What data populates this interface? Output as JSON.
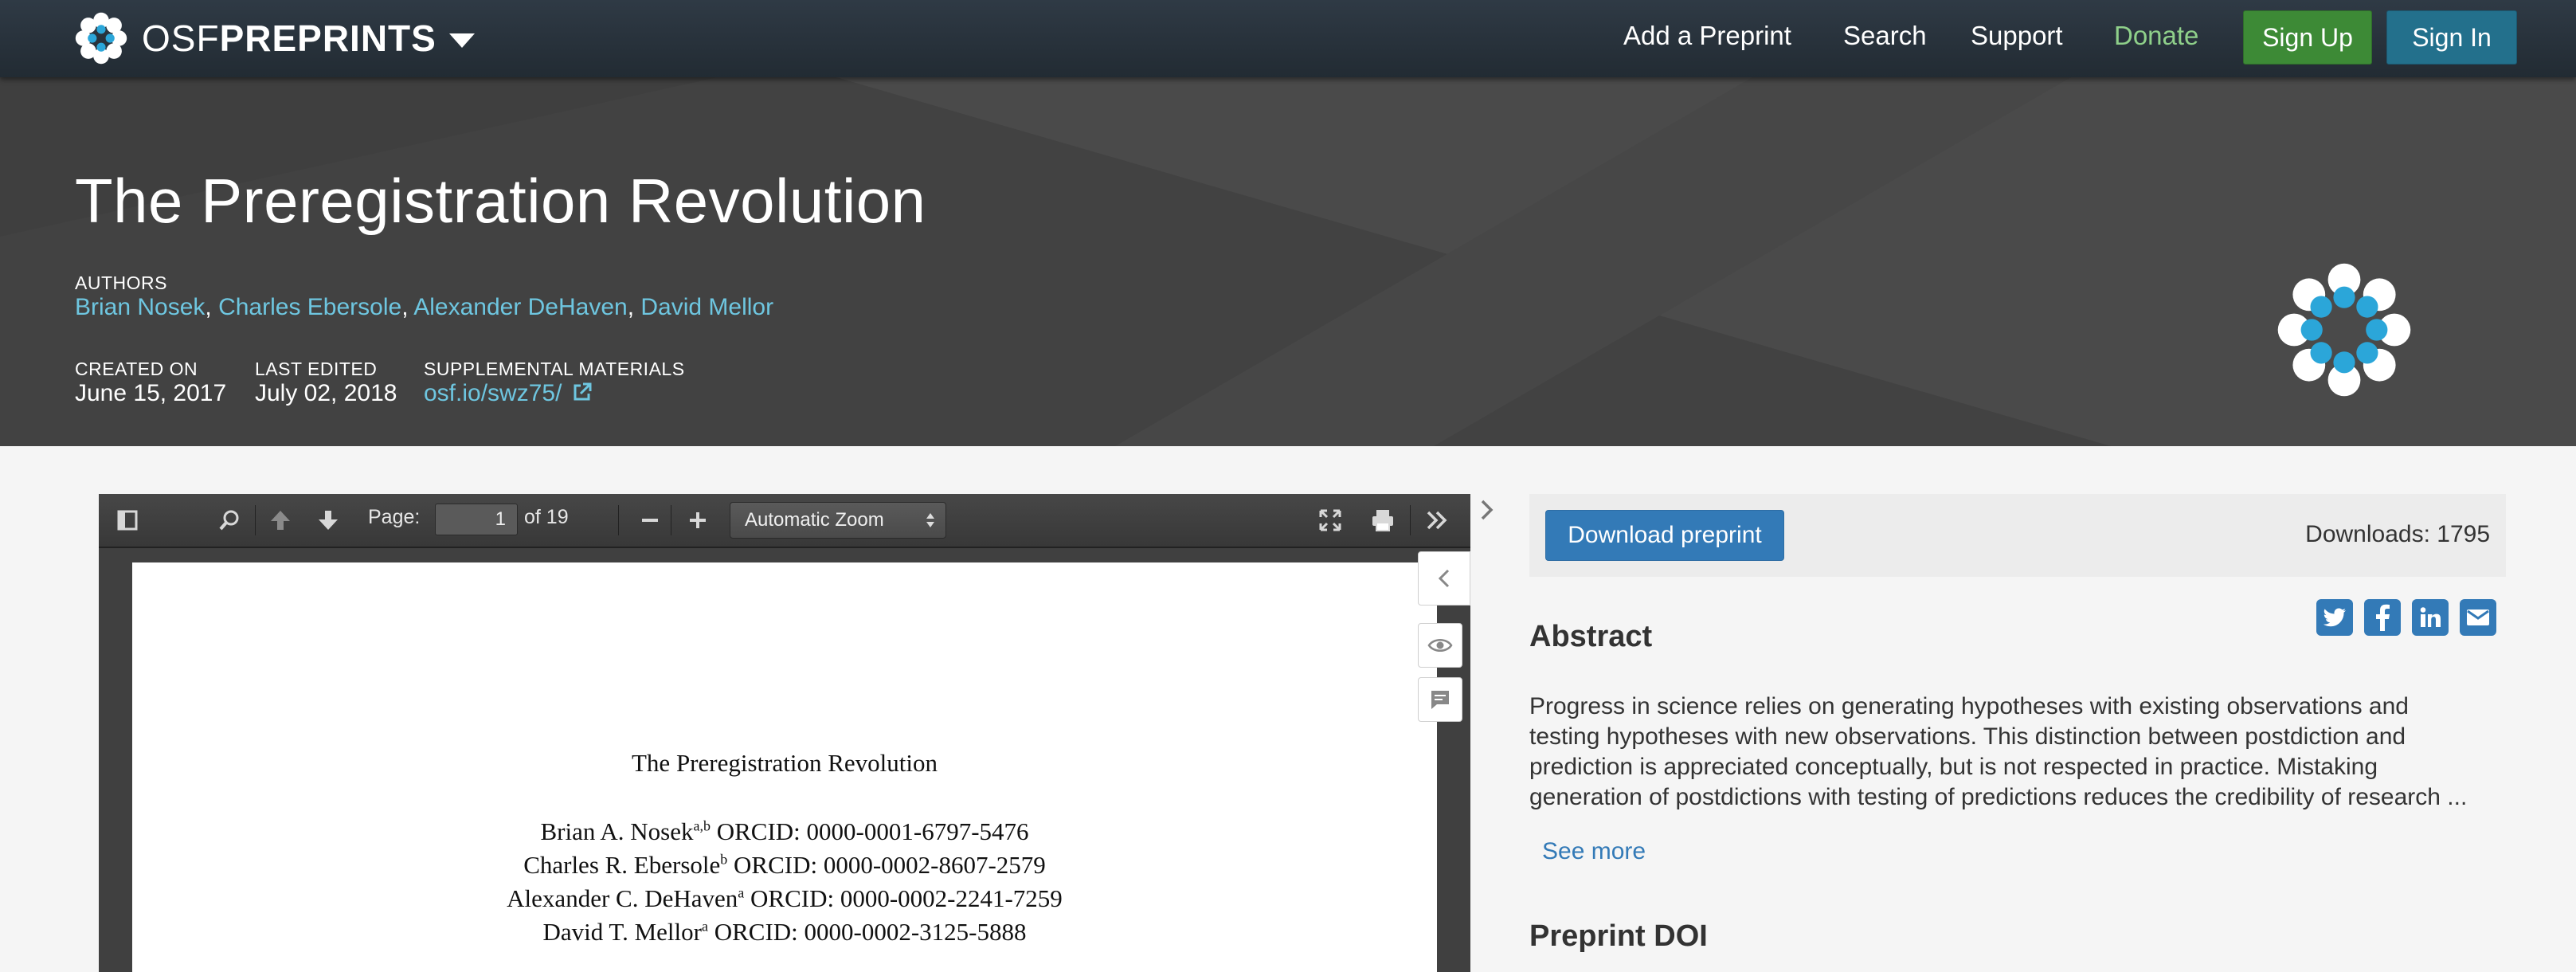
{
  "nav": {
    "brand_light": "OSF",
    "brand_bold": "PREPRINTS",
    "links": [
      "Add a Preprint",
      "Search",
      "Support",
      "Donate"
    ],
    "signup": "Sign Up",
    "signin": "Sign In"
  },
  "preprint": {
    "title": "The Preregistration Revolution",
    "authors_label": "AUTHORS",
    "authors": [
      "Brian Nosek",
      "Charles Ebersole",
      "Alexander DeHaven",
      "David Mellor"
    ],
    "created_label": "CREATED ON",
    "created": "June 15, 2017",
    "edited_label": "LAST EDITED",
    "edited": "July 02, 2018",
    "supp_label": "SUPPLEMENTAL MATERIALS",
    "supp_link": "osf.io/swz75/"
  },
  "viewer": {
    "page_label": "Page:",
    "page_value": "1",
    "page_of": "of 19",
    "zoom": "Automatic Zoom",
    "doc_title": "The Preregistration Revolution",
    "doc_authors": [
      {
        "name": "Brian A. Nosek",
        "sup": "a,b",
        "orcid": "ORCID: 0000-0001-6797-5476"
      },
      {
        "name": "Charles R. Ebersole",
        "sup": "b",
        "orcid": "ORCID: 0000-0002-8607-2579"
      },
      {
        "name": "Alexander C. DeHaven",
        "sup": "a",
        "orcid": "ORCID: 0000-0002-2241-7259"
      },
      {
        "name": "David T. Mellor",
        "sup": "a",
        "orcid": "ORCID: 0000-0002-3125-5888"
      }
    ]
  },
  "panel": {
    "download": "Download preprint",
    "downloads": "Downloads: 1795",
    "abstract_heading": "Abstract",
    "abstract": "Progress in science relies on generating hypotheses with existing observations and testing hypotheses with new observations. This distinction between postdiction and prediction is appreciated conceptually, but is not respected in practice. Mistaking generation of postdictions with testing of predictions reduces the credibility of research ...",
    "see_more": "See more",
    "doi_heading": "Preprint DOI",
    "share_icons": [
      "twitter-icon",
      "facebook-icon",
      "linkedin-icon",
      "email-icon"
    ]
  },
  "colors": {
    "navbar": "#2a333c",
    "header": "#454545",
    "link": "#6ec6e0",
    "signup": "#3d8a36",
    "signin": "#23708c",
    "primary": "#337ab7"
  }
}
